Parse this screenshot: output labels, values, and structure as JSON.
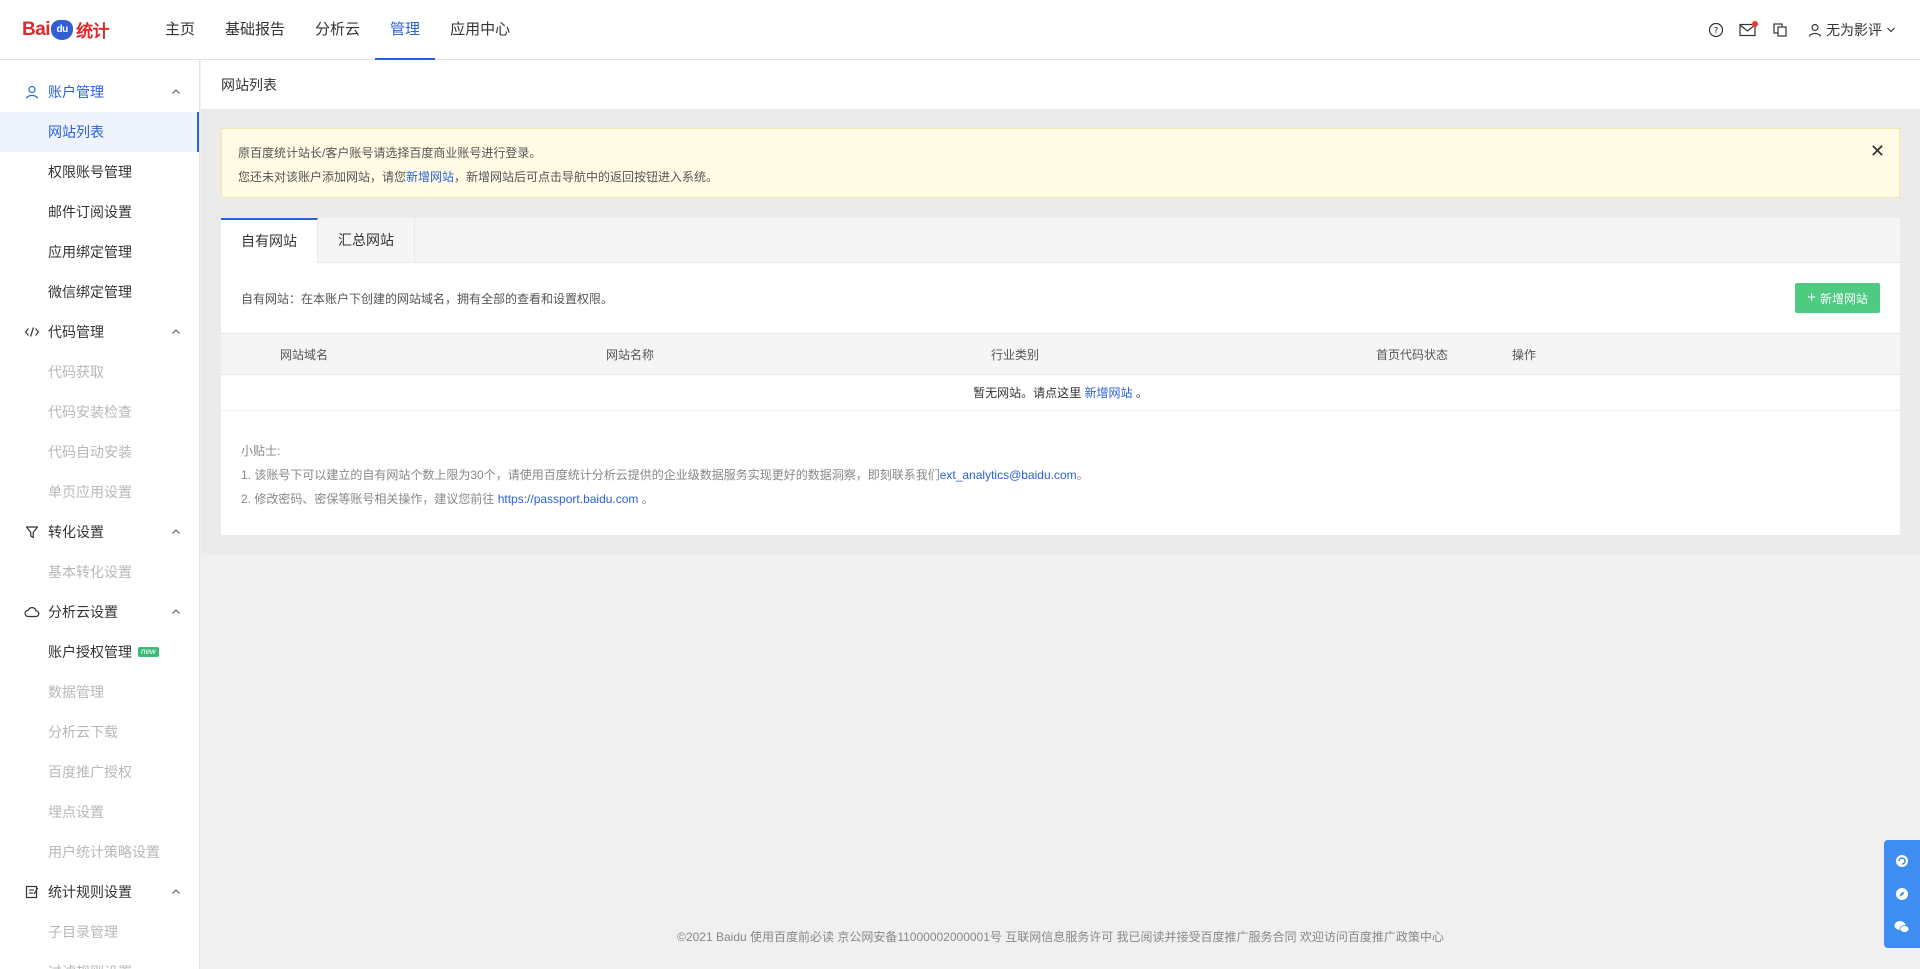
{
  "header": {
    "logo_text_1": "Bai",
    "logo_text_2": "du",
    "logo_text_cn": "统计",
    "nav": [
      "主页",
      "基础报告",
      "分析云",
      "管理",
      "应用中心"
    ],
    "active_nav": "管理",
    "user_name": "无为影评"
  },
  "sidebar": {
    "groups": [
      {
        "title": "账户管理",
        "icon": "user-icon",
        "items": [
          "网站列表",
          "权限账号管理",
          "邮件订阅设置",
          "应用绑定管理",
          "微信绑定管理"
        ]
      },
      {
        "title": "代码管理",
        "icon": "code-icon",
        "items": [
          "代码获取",
          "代码安装检查",
          "代码自动安装",
          "单页应用设置"
        ]
      },
      {
        "title": "转化设置",
        "icon": "funnel-icon",
        "items": [
          "基本转化设置"
        ]
      },
      {
        "title": "分析云设置",
        "icon": "cloud-icon",
        "items": [
          "账户授权管理",
          "数据管理",
          "分析云下载",
          "百度推广授权",
          "埋点设置",
          "用户统计策略设置"
        ]
      },
      {
        "title": "统计规则设置",
        "icon": "rules-icon",
        "items": [
          "子目录管理",
          "过滤规则设置"
        ]
      }
    ],
    "new_badge": "new"
  },
  "page": {
    "title": "网站列表",
    "alert_line1": "原百度统计站长/客户账号请选择百度商业账号进行登录。",
    "alert_line2_a": "您还未对该账户添加网站，请您",
    "alert_line2_link": "新增网站",
    "alert_line2_b": "，新增网站后可点击导航中的返回按钮进入系统。",
    "tabs": [
      "自有网站",
      "汇总网站"
    ],
    "desc": "自有网站：在本账户下创建的网站域名，拥有全部的查看和设置权限。",
    "add_button": "新增网站",
    "table_headers": [
      "网站域名",
      "网站名称",
      "行业类别",
      "首页代码状态",
      "操作"
    ],
    "empty_text": "暂无网站。请点这里",
    "empty_link": "新增网站",
    "empty_tail": "。",
    "tips_title": "小贴士:",
    "tip1_a": "1. 该账号下可以建立的自有网站个数上限为30个，请使用百度统计分析云提供的企业级数据服务实现更好的数据洞察，即刻联系我们",
    "tip1_link": "ext_analytics@baidu.com",
    "tip1_b": "。",
    "tip2_a": "2. 修改密码、密保等账号相关操作，建议您前往 ",
    "tip2_link": "https://passport.baidu.com",
    "tip2_b": " 。"
  },
  "footer": "©2021 Baidu 使用百度前必读 京公网安备11000002000001号 互联网信息服务许可 我已阅读并接受百度推广服务合同 欢迎访问百度推广政策中心",
  "colors": {
    "accent": "#2a62d8",
    "add_button": "#4ecb80",
    "alert_bg": "#fffbe5",
    "float_bar": "#3d8ef0"
  }
}
